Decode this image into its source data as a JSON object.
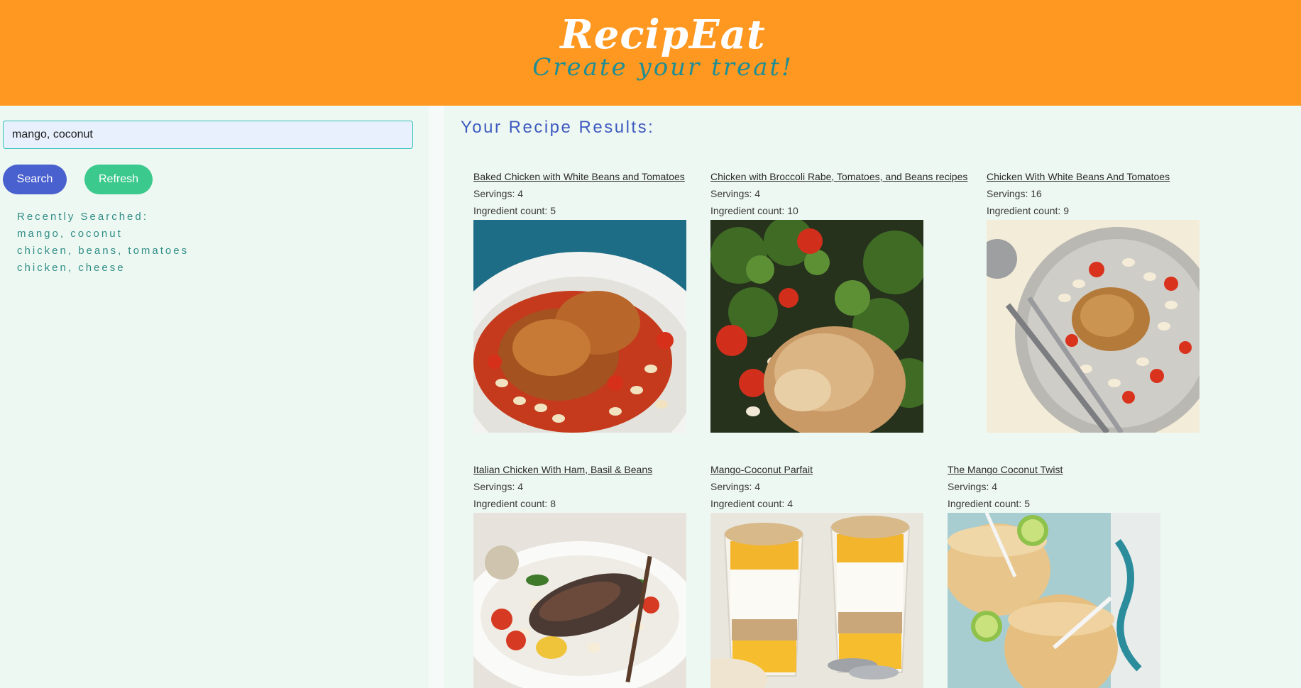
{
  "header": {
    "brand": "RecipEat",
    "tagline": "Create your treat!"
  },
  "sidebar": {
    "search_value": "mango, coconut",
    "search_label": "Search",
    "refresh_label": "Refresh",
    "recent_label": "Recently Searched:",
    "recent": [
      "mango, coconut",
      "chicken, beans, tomatoes",
      "chicken, cheese"
    ]
  },
  "main": {
    "results_title": "Your Recipe Results:",
    "servings_prefix": "Servings:",
    "ingredients_prefix": "Ingredient count:",
    "recipes": [
      {
        "title": "Baked Chicken with White Beans and Tomatoes",
        "servings": "4",
        "ingredient_count": "5",
        "image": "chicken-beans-tomatoes-photo"
      },
      {
        "title": "Chicken with Broccoli Rabe, Tomatoes, and Beans recipes",
        "servings": "4",
        "ingredient_count": "10",
        "image": "chicken-broccoli-rabe-photo"
      },
      {
        "title": "Chicken With White Beans And Tomatoes",
        "servings": "16",
        "ingredient_count": "9",
        "image": "chicken-plate-fork-photo"
      },
      {
        "title": "Italian Chicken With Ham, Basil & Beans",
        "servings": "4",
        "ingredient_count": "8",
        "image": "italian-chicken-photo"
      },
      {
        "title": "Mango-Coconut Parfait",
        "servings": "4",
        "ingredient_count": "4",
        "image": "mango-parfait-photo"
      },
      {
        "title": "The Mango Coconut Twist",
        "servings": "4",
        "ingredient_count": "5",
        "image": "mango-smoothie-photo"
      }
    ]
  },
  "colors": {
    "header_bg": "#ff9820",
    "page_bg": "#eef8f2",
    "search_button": "#4960cf",
    "refresh_button": "#3cc98d",
    "title_blue": "#3e5ac0",
    "teal": "#2f8d86"
  }
}
